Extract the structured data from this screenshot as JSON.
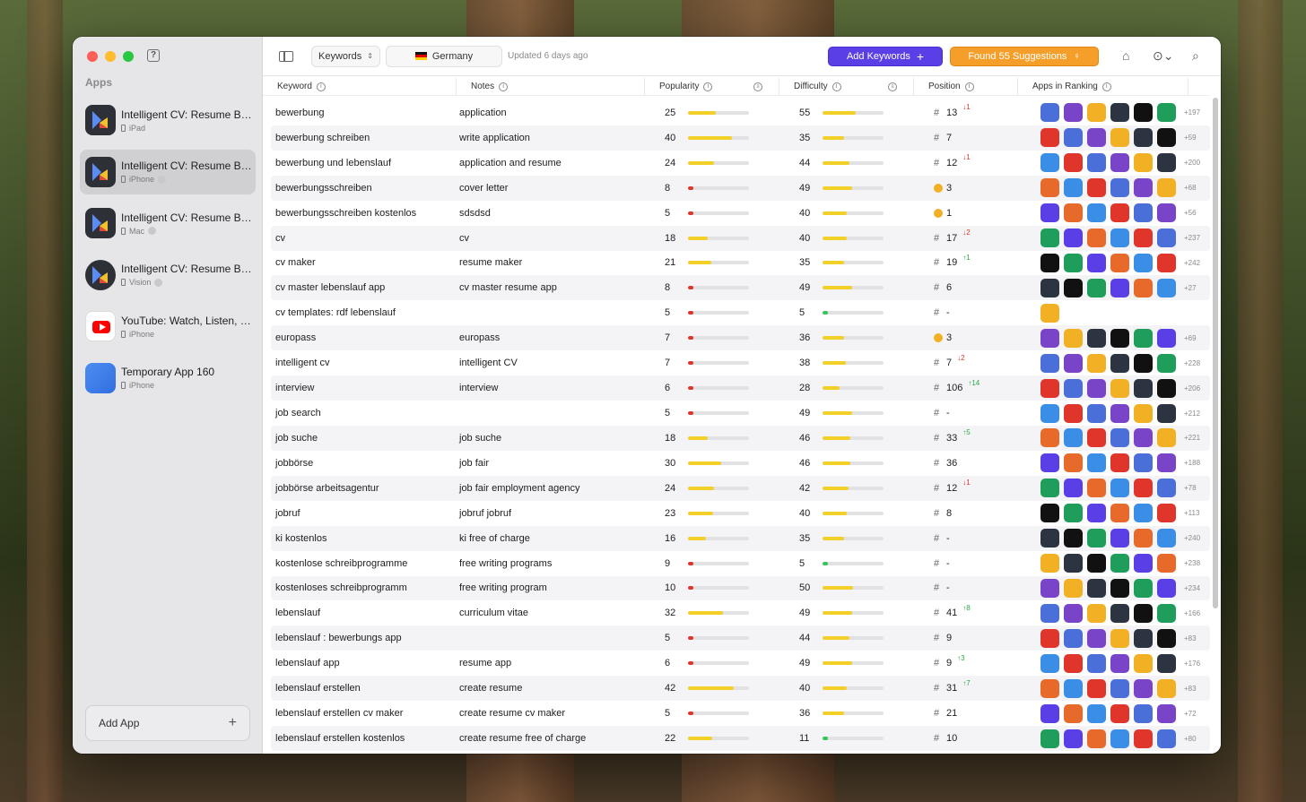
{
  "sidebar": {
    "section_label": "Apps",
    "apps": [
      {
        "name": "Intelligent CV: Resume Builder",
        "platform": "iPad",
        "icon": "intelligent-cv-icon",
        "selected": false
      },
      {
        "name": "Intelligent CV: Resume Builder",
        "platform": "iPhone",
        "icon": "intelligent-cv-icon",
        "selected": true
      },
      {
        "name": "Intelligent CV: Resume Builder",
        "platform": "Mac",
        "icon": "intelligent-cv-icon",
        "selected": false
      },
      {
        "name": "Intelligent CV: Resume Builder",
        "platform": "Vision",
        "icon": "intelligent-cv-icon",
        "selected": false
      },
      {
        "name": "YouTube: Watch, Listen, Stream",
        "platform": "iPhone",
        "icon": "youtube-icon",
        "selected": false
      },
      {
        "name": "Temporary App 160",
        "platform": "iPhone",
        "icon": "placeholder-app-icon",
        "selected": false
      }
    ],
    "add_app_label": "Add App",
    "add_icon": "+"
  },
  "toolbar": {
    "view_select": "Keywords",
    "country": "Germany",
    "updated": "Updated 6 days ago",
    "add_keywords": "Add Keywords",
    "found_suggestions": "Found 55 Suggestions"
  },
  "columns": {
    "keyword": "Keyword",
    "notes": "Notes",
    "popularity": "Popularity",
    "difficulty": "Difficulty",
    "position": "Position",
    "apps_in_ranking": "Apps in Ranking"
  },
  "colors": {
    "accent_purple": "#5b3fe6",
    "accent_orange": "#f59f2a",
    "bar_yellow": "#f2d027",
    "bar_red": "#e0352b",
    "bar_green": "#34c759"
  },
  "rows": [
    {
      "keyword": "bewerbung",
      "note": "application",
      "pop": 25,
      "diff": 55,
      "pos": "13",
      "medal": false,
      "change": "↓1",
      "dir": "down",
      "more": "+197"
    },
    {
      "keyword": "bewerbung schreiben",
      "note": "write application",
      "pop": 40,
      "diff": 35,
      "pos": "7",
      "medal": false,
      "change": "",
      "dir": "",
      "more": "+59"
    },
    {
      "keyword": "bewerbung und lebenslauf",
      "note": "application and resume",
      "pop": 24,
      "diff": 44,
      "pos": "12",
      "medal": false,
      "change": "↓1",
      "dir": "down",
      "more": "+200"
    },
    {
      "keyword": "bewerbungsschreiben",
      "note": "cover letter",
      "pop": 8,
      "diff": 49,
      "pos": "3",
      "medal": true,
      "change": "",
      "dir": "",
      "more": "+68"
    },
    {
      "keyword": "bewerbungsschreiben kostenlos",
      "note": "sdsdsd",
      "pop": 5,
      "diff": 40,
      "pos": "1",
      "medal": true,
      "change": "",
      "dir": "",
      "more": "+56"
    },
    {
      "keyword": "cv",
      "note": "cv",
      "pop": 18,
      "diff": 40,
      "pos": "17",
      "medal": false,
      "change": "↓2",
      "dir": "down",
      "more": "+237"
    },
    {
      "keyword": "cv maker",
      "note": "resume maker",
      "pop": 21,
      "diff": 35,
      "pos": "19",
      "medal": false,
      "change": "↑1",
      "dir": "up",
      "more": "+242"
    },
    {
      "keyword": "cv master lebenslauf app",
      "note": "cv master resume app",
      "pop": 8,
      "diff": 49,
      "pos": "6",
      "medal": false,
      "change": "",
      "dir": "",
      "more": "+27"
    },
    {
      "keyword": "cv templates: rdf lebenslauf",
      "note": "",
      "pop": 5,
      "diff": 5,
      "pos": "-",
      "medal": false,
      "change": "",
      "dir": "",
      "more": ""
    },
    {
      "keyword": "europass",
      "note": "europass",
      "pop": 7,
      "diff": 36,
      "pos": "3",
      "medal": true,
      "change": "",
      "dir": "",
      "more": "+69"
    },
    {
      "keyword": "intelligent cv",
      "note": "intelligent CV",
      "pop": 7,
      "diff": 38,
      "pos": "7",
      "medal": false,
      "change": "↓2",
      "dir": "down",
      "more": "+228"
    },
    {
      "keyword": "interview",
      "note": "interview",
      "pop": 6,
      "diff": 28,
      "pos": "106",
      "medal": false,
      "change": "↑14",
      "dir": "up",
      "more": "+206"
    },
    {
      "keyword": "job search",
      "note": "",
      "pop": 5,
      "diff": 49,
      "pos": "-",
      "medal": false,
      "change": "",
      "dir": "",
      "more": "+212"
    },
    {
      "keyword": "job suche",
      "note": "job suche",
      "pop": 18,
      "diff": 46,
      "pos": "33",
      "medal": false,
      "change": "↑5",
      "dir": "up",
      "more": "+221"
    },
    {
      "keyword": "jobbörse",
      "note": "job fair",
      "pop": 30,
      "diff": 46,
      "pos": "36",
      "medal": false,
      "change": "",
      "dir": "",
      "more": "+188"
    },
    {
      "keyword": "jobbörse arbeitsagentur",
      "note": "job fair employment agency",
      "pop": 24,
      "diff": 42,
      "pos": "12",
      "medal": false,
      "change": "↓1",
      "dir": "down",
      "more": "+78"
    },
    {
      "keyword": "jobruf",
      "note": "jobruf jobruf",
      "pop": 23,
      "diff": 40,
      "pos": "8",
      "medal": false,
      "change": "",
      "dir": "",
      "more": "+113"
    },
    {
      "keyword": "ki kostenlos",
      "note": "ki free of charge",
      "pop": 16,
      "diff": 35,
      "pos": "-",
      "medal": false,
      "change": "",
      "dir": "",
      "more": "+240"
    },
    {
      "keyword": "kostenlose schreibprogramme",
      "note": "free writing programs",
      "pop": 9,
      "diff": 5,
      "pos": "-",
      "medal": false,
      "change": "",
      "dir": "",
      "more": "+238"
    },
    {
      "keyword": "kostenloses schreibprogramm",
      "note": "free writing program",
      "pop": 10,
      "diff": 50,
      "pos": "-",
      "medal": false,
      "change": "",
      "dir": "",
      "more": "+234"
    },
    {
      "keyword": "lebenslauf",
      "note": "curriculum vitae",
      "pop": 32,
      "diff": 49,
      "pos": "41",
      "medal": false,
      "change": "↑8",
      "dir": "up",
      "more": "+166"
    },
    {
      "keyword": "lebenslauf : bewerbungs app",
      "note": "",
      "pop": 5,
      "diff": 44,
      "pos": "9",
      "medal": false,
      "change": "",
      "dir": "",
      "more": "+83"
    },
    {
      "keyword": "lebenslauf app",
      "note": "resume app",
      "pop": 6,
      "diff": 49,
      "pos": "9",
      "medal": false,
      "change": "↑3",
      "dir": "up",
      "more": "+176"
    },
    {
      "keyword": "lebenslauf erstellen",
      "note": "create resume",
      "pop": 42,
      "diff": 40,
      "pos": "31",
      "medal": false,
      "change": "↑7",
      "dir": "up",
      "more": "+83"
    },
    {
      "keyword": "lebenslauf erstellen cv maker",
      "note": "create resume cv maker",
      "pop": 5,
      "diff": 36,
      "pos": "21",
      "medal": false,
      "change": "",
      "dir": "",
      "more": "+72"
    },
    {
      "keyword": "lebenslauf erstellen kostenlos",
      "note": "create resume free of charge",
      "pop": 22,
      "diff": 11,
      "pos": "10",
      "medal": false,
      "change": "",
      "dir": "",
      "more": "+80"
    }
  ]
}
